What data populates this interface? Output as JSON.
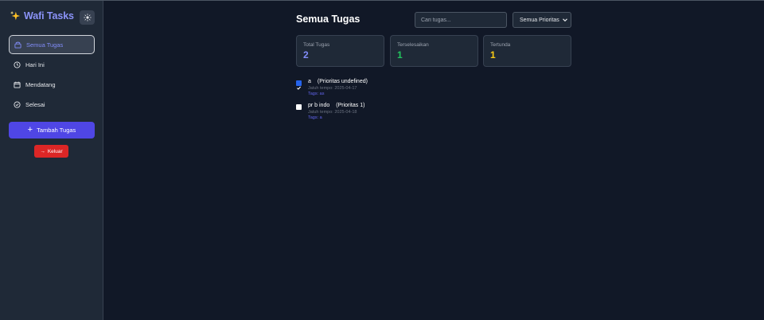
{
  "app": {
    "title": "Wafi Tasks"
  },
  "sidebar": {
    "items": [
      {
        "label": "Semua Tugas",
        "icon": "inbox-icon",
        "active": true
      },
      {
        "label": "Hari Ini",
        "icon": "clock-icon",
        "active": false
      },
      {
        "label": "Mendatang",
        "icon": "calendar-icon",
        "active": false
      },
      {
        "label": "Selesai",
        "icon": "check-circle-icon",
        "active": false
      }
    ],
    "add_label": "Tambah Tugas",
    "logout_label": "Keluar"
  },
  "main": {
    "title": "Semua Tugas",
    "search_placeholder": "Cari tugas...",
    "filter_selected": "Semua Prioritas"
  },
  "stats": [
    {
      "label": "Total Tugas",
      "value": "2",
      "color": "#818cf8"
    },
    {
      "label": "Terselesaikan",
      "value": "1",
      "color": "#22c55e"
    },
    {
      "label": "Tertunda",
      "value": "1",
      "color": "#facc15"
    }
  ],
  "tasks": [
    {
      "title": "a",
      "priority": "(Prioritas undefined)",
      "due": "Jatuh tempo: 2025-04-17",
      "tags": "Tags: as",
      "checked": true
    },
    {
      "title": "pr b indo",
      "priority": "(Prioritas 1)",
      "due": "Jatuh tempo: 2025-04-18",
      "tags": "Tags: a",
      "checked": false
    }
  ],
  "colors": {
    "accent": "#4f46e5",
    "danger": "#dc2626",
    "background": "#111827",
    "sidebar": "#1f2937"
  }
}
